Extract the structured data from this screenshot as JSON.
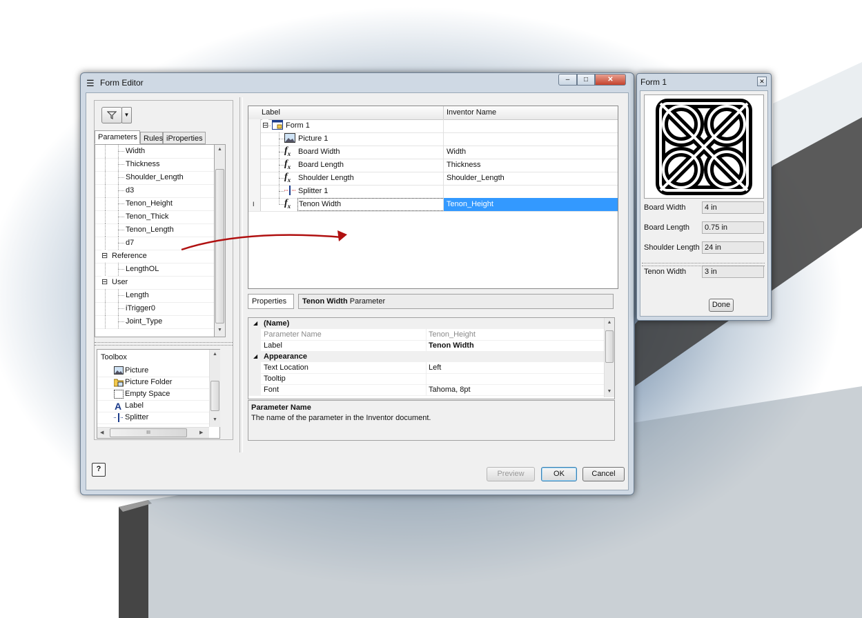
{
  "form_editor": {
    "title": "Form Editor",
    "tabs": [
      {
        "label": "Parameters"
      },
      {
        "label": "Rules"
      },
      {
        "label": "iProperties"
      }
    ],
    "param_tree": [
      {
        "label": "Width",
        "level": 2
      },
      {
        "label": "Thickness",
        "level": 2
      },
      {
        "label": "Shoulder_Length",
        "level": 2
      },
      {
        "label": "d3",
        "level": 2
      },
      {
        "label": "Tenon_Height",
        "level": 2
      },
      {
        "label": "Tenon_Thick",
        "level": 2
      },
      {
        "label": "Tenon_Length",
        "level": 2
      },
      {
        "label": "d7",
        "level": 2
      },
      {
        "label": "Reference",
        "level": 1,
        "expander": "⊟"
      },
      {
        "label": "LengthOL",
        "level": 2
      },
      {
        "label": "User",
        "level": 1,
        "expander": "⊟"
      },
      {
        "label": "Length",
        "level": 2
      },
      {
        "label": "iTrigger0",
        "level": 2
      },
      {
        "label": "Joint_Type",
        "level": 2
      }
    ],
    "toolbox": {
      "title": "Toolbox",
      "items": [
        {
          "label": "Picture",
          "icon": "picture-icon"
        },
        {
          "label": "Picture Folder",
          "icon": "picture-folder-icon"
        },
        {
          "label": "Empty Space",
          "icon": "empty-space-icon"
        },
        {
          "label": "Label",
          "icon": "label-icon"
        },
        {
          "label": "Splitter",
          "icon": "splitter-icon"
        }
      ],
      "hscroll_grip": "III"
    },
    "grid": {
      "columns": [
        "Label",
        "Inventor Name"
      ],
      "rows": [
        {
          "label": "Form 1",
          "name": "",
          "icon": "form-icon",
          "level": 0
        },
        {
          "label": "Picture 1",
          "name": "",
          "icon": "picture-icon",
          "level": 1
        },
        {
          "label": "Board Width",
          "name": "Width",
          "icon": "fx-icon",
          "level": 1
        },
        {
          "label": "Board Length",
          "name": "Thickness",
          "icon": "fx-icon",
          "level": 1
        },
        {
          "label": "Shoulder Length",
          "name": "Shoulder_Length",
          "icon": "fx-icon",
          "level": 1
        },
        {
          "label": "Splitter 1",
          "name": "",
          "icon": "splitter-icon",
          "level": 1
        },
        {
          "label": "Tenon Width",
          "name": "Tenon_Height",
          "icon": "fx-icon",
          "level": 1,
          "selected": true
        }
      ],
      "row_marker": "I"
    },
    "properties": {
      "tab_label": "Properties",
      "header_bold": "Tenon Width",
      "header_rest": "Parameter",
      "sections": [
        {
          "title": "(Name)",
          "rows": [
            {
              "name": "Parameter Name",
              "value": "Tenon_Height",
              "grey": true
            },
            {
              "name": "Label",
              "value": "Tenon Width",
              "bold": true
            }
          ]
        },
        {
          "title": "Appearance",
          "rows": [
            {
              "name": "Text Location",
              "value": "Left"
            },
            {
              "name": "Tooltip",
              "value": ""
            },
            {
              "name": "Font",
              "value": "Tahoma, 8pt"
            }
          ]
        }
      ],
      "description_title": "Parameter Name",
      "description_text": "The name of the parameter in the Inventor document."
    },
    "buttons": {
      "preview": "Preview",
      "ok": "OK",
      "cancel": "Cancel",
      "help": "?"
    }
  },
  "form1": {
    "title": "Form 1",
    "fields": [
      {
        "label": "Board Width",
        "value": "4 in"
      },
      {
        "label": "Board Length",
        "value": "0.75 in"
      },
      {
        "label": "Shoulder Length",
        "value": "24 in"
      },
      {
        "label": "Tenon Width",
        "value": "3 in"
      }
    ],
    "done_label": "Done"
  },
  "colors": {
    "selection": "#3399ff",
    "drag_arrow": "#b01010"
  }
}
